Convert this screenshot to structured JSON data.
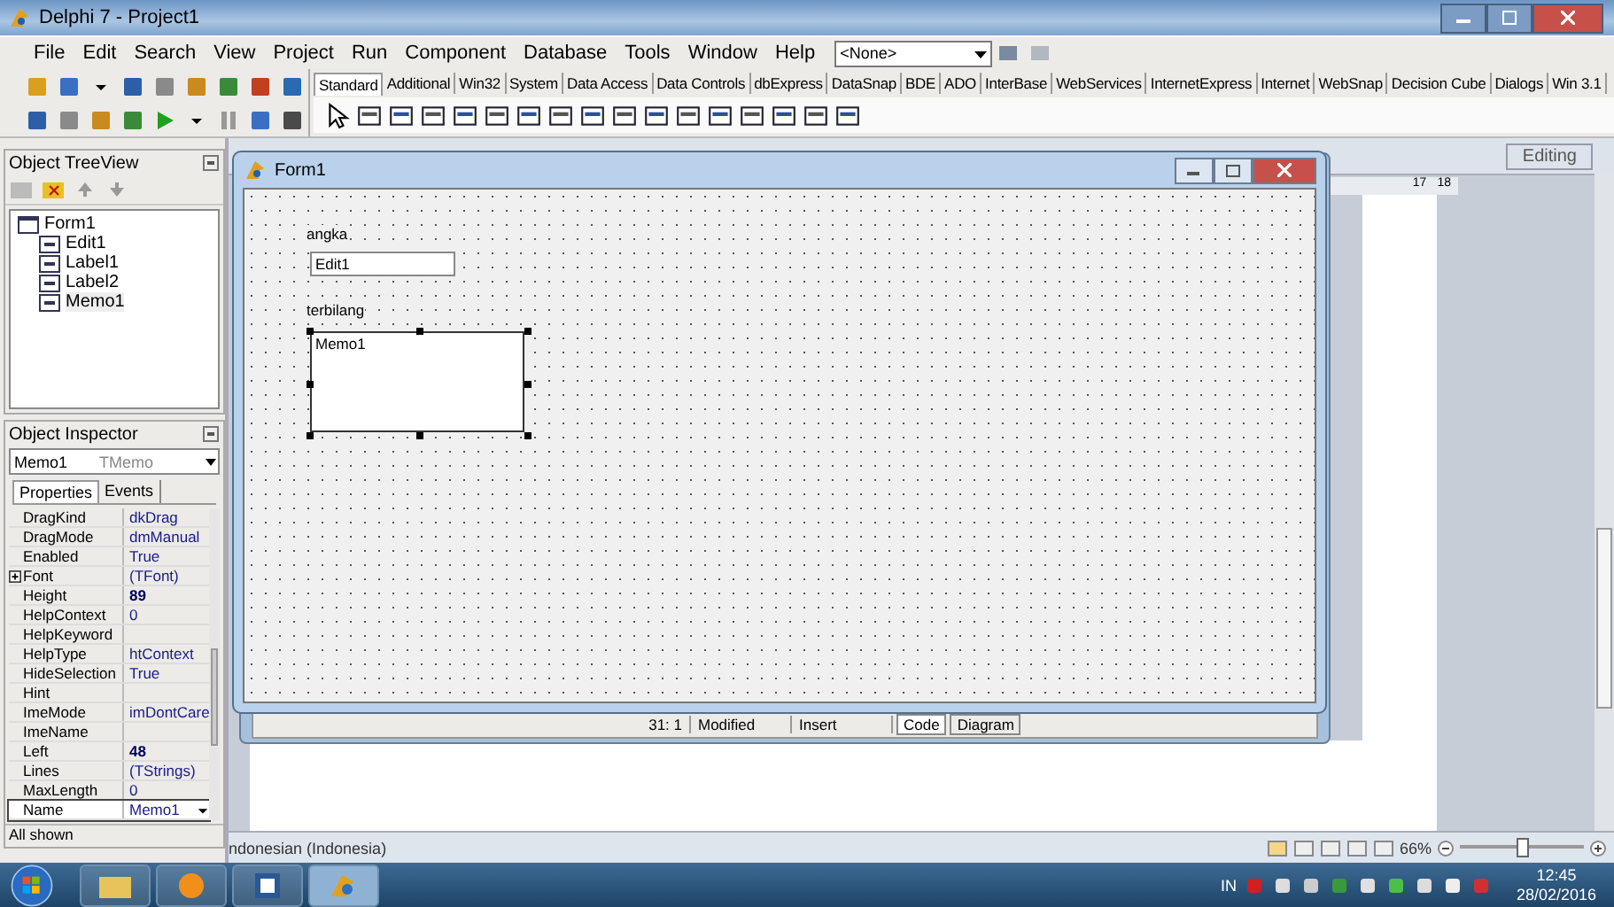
{
  "ide_window": {
    "title": "Delphi 7 - Project1"
  },
  "menu": [
    "File",
    "Edit",
    "Search",
    "View",
    "Project",
    "Run",
    "Component",
    "Database",
    "Tools",
    "Window",
    "Help"
  ],
  "component_dropdown": {
    "value": "<None>"
  },
  "palette_tabs": [
    {
      "label": "Standard",
      "selected": true
    },
    {
      "label": "Additional",
      "selected": false
    },
    {
      "label": "Win32",
      "selected": false
    },
    {
      "label": "System",
      "selected": false
    },
    {
      "label": "Data Access",
      "selected": false
    },
    {
      "label": "Data Controls",
      "selected": false
    },
    {
      "label": "dbExpress",
      "selected": false
    },
    {
      "label": "DataSnap",
      "selected": false
    },
    {
      "label": "BDE",
      "selected": false
    },
    {
      "label": "ADO",
      "selected": false
    },
    {
      "label": "InterBase",
      "selected": false
    },
    {
      "label": "WebServices",
      "selected": false
    },
    {
      "label": "InternetExpress",
      "selected": false
    },
    {
      "label": "Internet",
      "selected": false
    },
    {
      "label": "WebSnap",
      "selected": false
    },
    {
      "label": "Decision Cube",
      "selected": false
    },
    {
      "label": "Dialogs",
      "selected": false
    },
    {
      "label": "Win 3.1",
      "selected": false
    }
  ],
  "tree_view": {
    "title": "Object TreeView",
    "root": {
      "label": "Form1",
      "children": [
        {
          "label": "Edit1",
          "selected": false
        },
        {
          "label": "Label1",
          "selected": false
        },
        {
          "label": "Label2",
          "selected": false
        },
        {
          "label": "Memo1",
          "selected": true
        }
      ]
    }
  },
  "object_inspector": {
    "title": "Object Inspector",
    "object": "Memo1",
    "type": "TMemo",
    "tabs": [
      {
        "label": "Properties",
        "selected": true
      },
      {
        "label": "Events",
        "selected": false
      }
    ],
    "properties": [
      {
        "name": "DragKind",
        "value": "dkDrag",
        "modified": false,
        "expandable": false,
        "selected": false
      },
      {
        "name": "DragMode",
        "value": "dmManual",
        "modified": false,
        "expandable": false,
        "selected": false
      },
      {
        "name": "Enabled",
        "value": "True",
        "modified": false,
        "expandable": false,
        "selected": false
      },
      {
        "name": "Font",
        "value": "(TFont)",
        "modified": false,
        "expandable": true,
        "selected": false
      },
      {
        "name": "Height",
        "value": "89",
        "modified": true,
        "expandable": false,
        "selected": false
      },
      {
        "name": "HelpContext",
        "value": "0",
        "modified": false,
        "expandable": false,
        "selected": false
      },
      {
        "name": "HelpKeyword",
        "expandable": false,
        "selected": false
      },
      {
        "name": "HelpType",
        "value": "htContext",
        "modified": false,
        "expandable": false,
        "selected": false
      },
      {
        "name": "HideSelection",
        "value": "True",
        "modified": false,
        "expandable": false,
        "selected": false
      },
      {
        "name": "Hint",
        "expandable": false,
        "selected": false
      },
      {
        "name": "ImeMode",
        "value": "imDontCare",
        "modified": false,
        "expandable": false,
        "selected": false
      },
      {
        "name": "ImeName",
        "expandable": false,
        "selected": false
      },
      {
        "name": "Left",
        "value": "48",
        "modified": true,
        "expandable": false,
        "selected": false
      },
      {
        "name": "Lines",
        "value": "(TStrings)",
        "modified": false,
        "expandable": false,
        "selected": false
      },
      {
        "name": "MaxLength",
        "value": "0",
        "modified": false,
        "expandable": false,
        "selected": false
      },
      {
        "name": "Name",
        "value": "Memo1",
        "modified": false,
        "expandable": false,
        "selected": true
      }
    ],
    "status": "All shown"
  },
  "form": {
    "title": "Form1",
    "label_1": "angka",
    "edit_text": "Edit1",
    "label_2": "terbilang",
    "memo_text": "Memo1",
    "memo_selected": true
  },
  "code_editor": {
    "position": "31:  1",
    "state": "Modified",
    "mode": "Insert",
    "tabs": [
      {
        "label": "Code",
        "selected": true
      },
      {
        "label": "Diagram",
        "selected": false
      }
    ]
  },
  "word": {
    "editing": "Editing",
    "ruler_labels": [
      "17",
      "18"
    ],
    "language": "ndonesian (Indonesia)",
    "zoom": "66%",
    "zoom_slider": {
      "level": 0.5
    }
  },
  "taskbar": {
    "language": "IN",
    "time": "12:45",
    "date": "28/02/2016"
  }
}
